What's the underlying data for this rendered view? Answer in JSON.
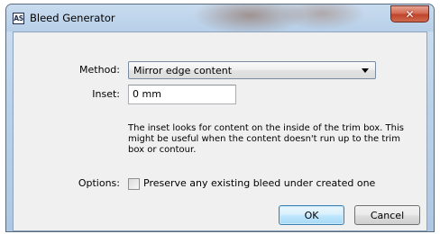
{
  "window": {
    "title": "Bleed Generator",
    "app_icon_text": "AS",
    "close_icon": "close-icon"
  },
  "form": {
    "method": {
      "label": "Method:",
      "selected": "Mirror edge content"
    },
    "inset": {
      "label": "Inset:",
      "value": "0 mm"
    },
    "description": "The inset looks for content on the inside of the trim box. This might be useful when the content doesn't run up to the trim box or contour.",
    "options": {
      "label": "Options:",
      "checkbox_label": "Preserve any existing bleed under created one",
      "checked": false
    }
  },
  "buttons": {
    "ok": "OK",
    "cancel": "Cancel"
  },
  "colors": {
    "close_button": "#c9513a",
    "default_button_border": "#3c7fb1",
    "dialog_background": "#f0f0f0"
  }
}
